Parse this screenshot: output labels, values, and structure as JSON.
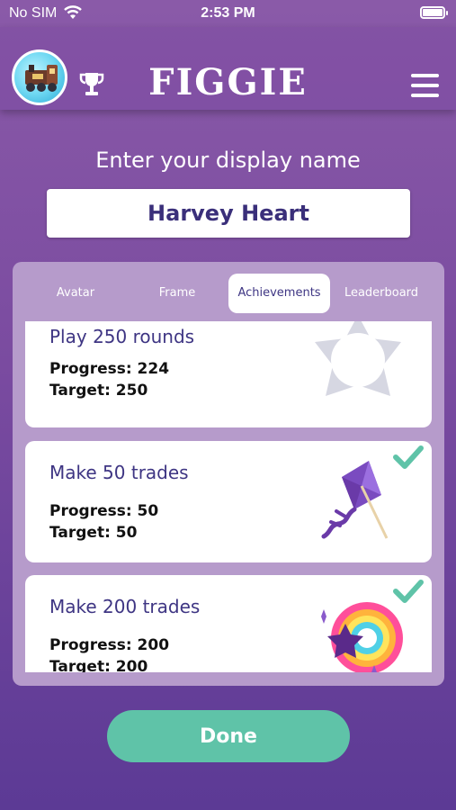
{
  "status_bar": {
    "carrier": "No SIM",
    "time": "2:53 PM"
  },
  "header": {
    "logo": "FIGGIE"
  },
  "display_name": {
    "label": "Enter your display name",
    "value": "Harvey Heart"
  },
  "tabs": [
    {
      "label": "Avatar",
      "active": false
    },
    {
      "label": "Frame",
      "active": false
    },
    {
      "label": "Achievements",
      "active": true
    },
    {
      "label": "Leaderboard",
      "active": false
    }
  ],
  "achievements": [
    {
      "title": "Play 250 rounds",
      "progress": "Progress: 224",
      "target": "Target: 250",
      "completed": false,
      "icon": "star-badge-icon"
    },
    {
      "title": "Make 50 trades",
      "progress": "Progress: 50",
      "target": "Target: 50",
      "completed": true,
      "icon": "kite-icon"
    },
    {
      "title": "Make 200 trades",
      "progress": "Progress: 200",
      "target": "Target: 200",
      "completed": true,
      "icon": "rainbow-icon"
    }
  ],
  "done_button": "Done",
  "colors": {
    "accent": "#5fc3a8",
    "title_text": "#3e3583",
    "panel": "#b69bcb"
  }
}
